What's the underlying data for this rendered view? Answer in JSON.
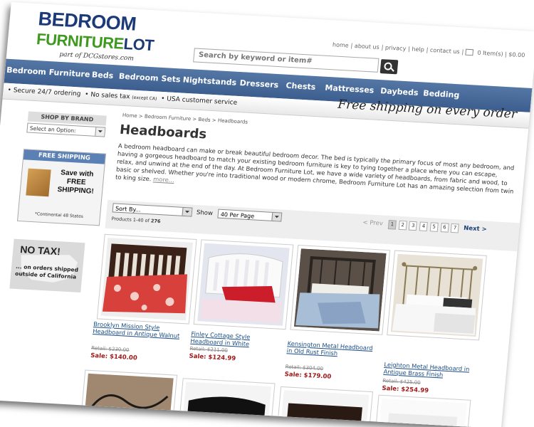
{
  "header": {
    "logo_line1": "BEDROOM",
    "logo_line2a": "FURNITURE",
    "logo_line2b": "LOT",
    "logo_tagline": "part of DCGstores.com",
    "top_links": [
      "home",
      "about us",
      "privacy",
      "help",
      "contact us"
    ],
    "cart_text": "0 Item(s) | $0.00",
    "search_placeholder": "Search by keyword or item#"
  },
  "nav": [
    "Bedroom Furniture",
    "Beds",
    "Bedroom Sets",
    "Nightstands",
    "Dressers",
    "Chests",
    "Mattresses",
    "Daybeds",
    "Bedding"
  ],
  "infobar": {
    "msg1": "Secure 24/7 ordering",
    "msg2": "No sales tax",
    "msg2_small": "(except CA)",
    "msg3": "USA customer service",
    "free_shipping_banner": "Free shipping on every order"
  },
  "sidebar": {
    "shop_by_brand": "SHOP BY BRAND",
    "brand_select": "Select an Option:",
    "free_shipping_title": "FREE SHIPPING",
    "save_with": "Save with",
    "free": "FREE",
    "shipping": "SHIPPING!",
    "continental": "*Continental 48 States",
    "no_tax": "NO TAX!",
    "no_tax_sub": "... on orders shipped outside of California"
  },
  "main": {
    "breadcrumb": "Home > Bedroom Furniture > Beds > Headboards",
    "title": "Headboards",
    "description": "A bedroom headboard can make or break beautiful bedroom decor. The bed is typically the primary focus of most any bedroom, and having a gorgeous headboard to match your existing bedroom furniture is key to tying together a place where you can escape, relax, and unwind at the end of the day. At Bedroom Furniture Lot, we have a wide variety of headboards, from fabric and wood, to basic or shelved. Whether you're into traditional wood or modern chrome, Bedroom Furniture Lot has an amazing selection from twin to king size.",
    "more": "more..."
  },
  "toolbar": {
    "sort_label": "Sort By...",
    "show_label": "Show",
    "per_page": "40 Per Page",
    "products_prefix": "Products 1-40 of",
    "products_total": "276",
    "prev": "< Prev",
    "pages": [
      "1",
      "2",
      "3",
      "4",
      "5",
      "6",
      "7"
    ],
    "next": "Next >"
  },
  "products": [
    {
      "name": "Brooklyn Mission Style Headboard in Antique Walnut",
      "retail": "Retail: $230.00",
      "sale": "Sale: $140.00"
    },
    {
      "name": "Finley Cottage Style Headboard in White",
      "retail": "Retail: $211.00",
      "sale": "Sale: $124.99"
    },
    {
      "name": "Kensington Metal Headboard in Old Rust Finish",
      "retail": "Retail: $304.00",
      "sale": "Sale: $179.00"
    },
    {
      "name": "Leighton Metal Headboard in Antique Brass Finish",
      "retail": "Retail: $425.00",
      "sale": "Sale: $254.99"
    }
  ]
}
